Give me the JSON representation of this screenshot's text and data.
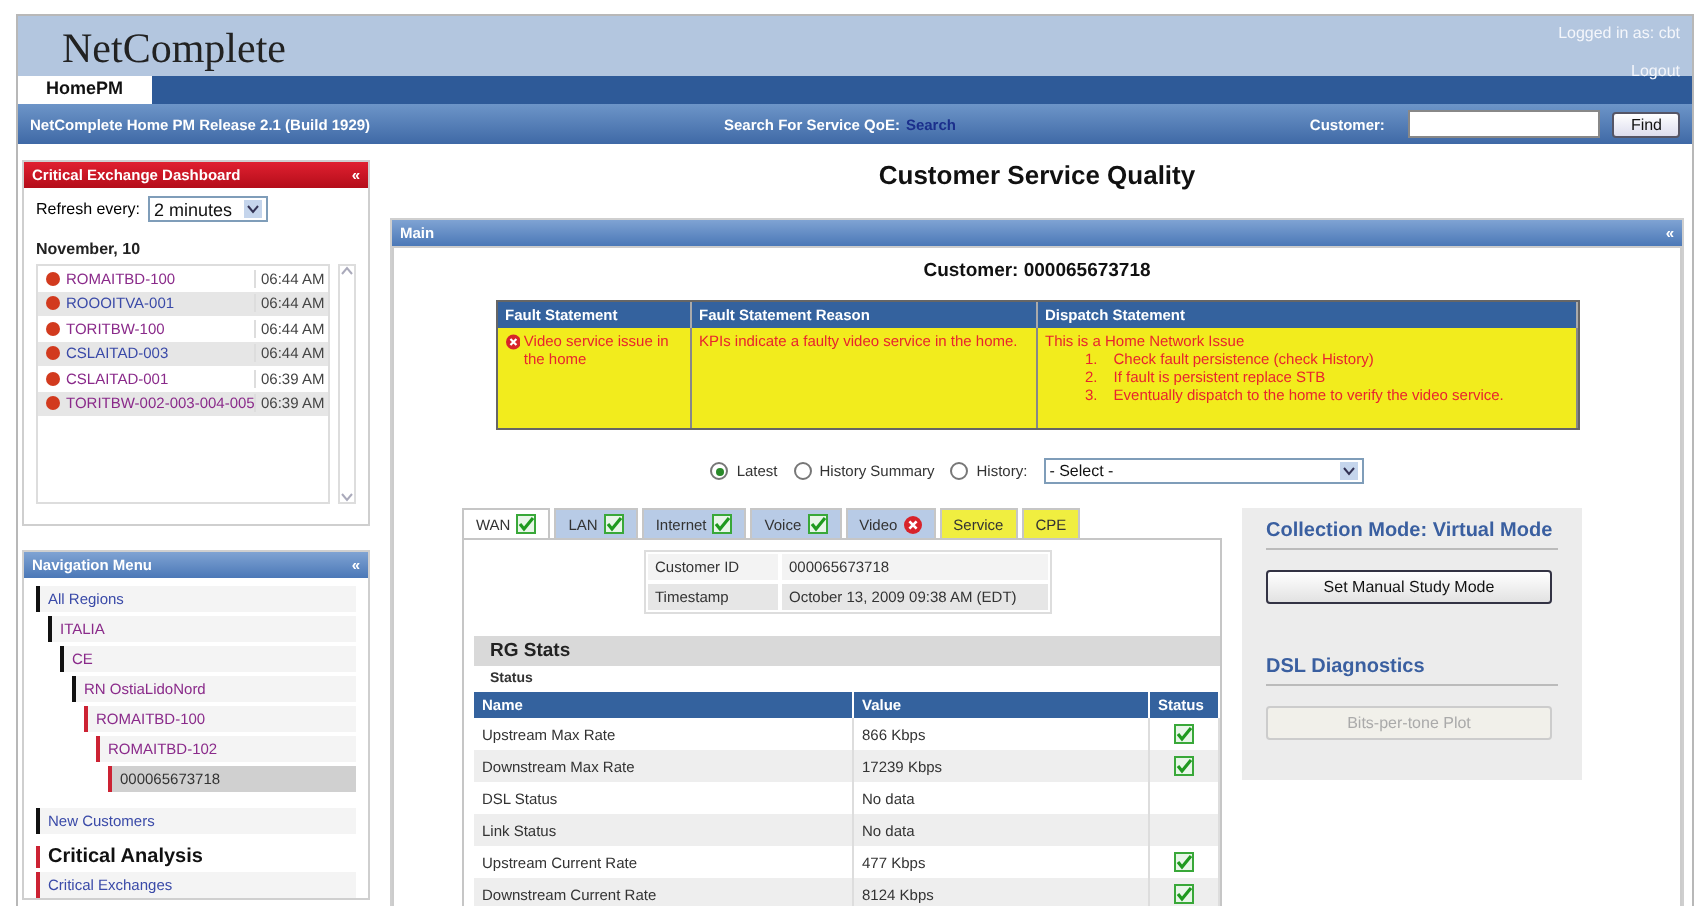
{
  "header": {
    "logo": "NetComplete",
    "logged_in": "Logged in as: cbt",
    "logout": "Logout"
  },
  "app_tabs": [
    {
      "label": "HomePM",
      "selected": true
    }
  ],
  "subbar": {
    "release": "NetComplete Home PM Release 2.1 (Build 1929)",
    "search_label": "Search For Service QoE:",
    "search_link": "Search",
    "customer_label": "Customer:",
    "find_button": "Find"
  },
  "dashboard": {
    "title": "Critical Exchange Dashboard",
    "collapse": "«",
    "refresh_label": "Refresh every:",
    "refresh_value": "2 minutes",
    "date": "November, 10",
    "rows": [
      {
        "name": "ROMAITBD-100",
        "time": "06:44 AM",
        "visited": true
      },
      {
        "name": "ROOOITVA-001",
        "time": "06:44 AM",
        "visited": false
      },
      {
        "name": "TORITBW-100",
        "time": "06:44 AM",
        "visited": true
      },
      {
        "name": "CSLAITAD-003",
        "time": "06:44 AM",
        "visited": false
      },
      {
        "name": "CSLAITAD-001",
        "time": "06:39 AM",
        "visited": true
      },
      {
        "name": "TORITBW-002-003-004-005",
        "time": "06:39 AM",
        "visited": true
      }
    ]
  },
  "navigation": {
    "title": "Navigation Menu",
    "collapse": "«",
    "tree": [
      {
        "label": "All Regions",
        "color": "#111111",
        "selected": false,
        "children": [
          {
            "label": "ITALIA",
            "color": "#111111",
            "selected": false,
            "children": [
              {
                "label": "CE",
                "color": "#111111",
                "selected": false,
                "children": [
                  {
                    "label": "RN OstiaLidoNord",
                    "color": "#111111",
                    "selected": false,
                    "children": [
                      {
                        "label": "ROMAITBD-100",
                        "color": "#cc2233",
                        "selected": false,
                        "children": [
                          {
                            "label": "ROMAITBD-102",
                            "color": "#cc2233",
                            "selected": false,
                            "children": [
                              {
                                "label": "000065673718",
                                "color": "#cc2233",
                                "selected": true
                              }
                            ]
                          }
                        ]
                      }
                    ]
                  }
                ]
              }
            ]
          }
        ]
      },
      {
        "label": "New Customers",
        "color": "#111111",
        "selected": false
      }
    ],
    "section": {
      "title": "Critical Analysis",
      "color": "#cc2233"
    },
    "section_items": [
      {
        "label": "Critical Exchanges",
        "color": "#cc2233",
        "selected": false
      }
    ]
  },
  "page_title": "Customer Service Quality",
  "main": {
    "title": "Main",
    "collapse": "«",
    "customer": "Customer: 000065673718",
    "fault_table": {
      "columns": [
        "Fault Statement",
        "Fault Statement Reason",
        "Dispatch Statement"
      ],
      "fault": "Video service issue in the home",
      "reason": "KPIs indicate a faulty video service in the home.",
      "dispatch_title": "This is a Home Network Issue",
      "dispatch_steps": [
        {
          "number": "1.",
          "text": "Check fault persistence (check History)"
        },
        {
          "number": "2.",
          "text": "If fault is persistent replace STB"
        },
        {
          "number": "3.",
          "text": "Eventually dispatch to the home to verify the video service."
        }
      ]
    },
    "history": [
      {
        "label": "Latest",
        "selected": true
      },
      {
        "label": "History Summary",
        "selected": false
      },
      {
        "label": "History:",
        "selected": false
      }
    ],
    "history_select": "- Select -",
    "tabs": [
      {
        "label": "WAN",
        "kind": "ok",
        "selected": true,
        "highlight": false
      },
      {
        "label": "LAN",
        "kind": "ok",
        "selected": false,
        "highlight": false
      },
      {
        "label": "Internet",
        "kind": "ok",
        "selected": false,
        "highlight": false
      },
      {
        "label": "Voice",
        "kind": "ok",
        "selected": false,
        "highlight": false
      },
      {
        "label": "Video",
        "kind": "error",
        "selected": false,
        "highlight": false
      },
      {
        "label": "Service",
        "kind": "plain",
        "selected": false,
        "highlight": true
      },
      {
        "label": "CPE",
        "kind": "plain",
        "selected": false,
        "highlight": true
      }
    ],
    "info": [
      {
        "label": "Customer ID",
        "value": "000065673718"
      },
      {
        "label": "Timestamp",
        "value": "October 13, 2009 09:38 AM (EDT)"
      }
    ],
    "stats_title": "RG Stats",
    "stats_subtitle": "Status",
    "stats_columns": [
      "Name",
      "Value",
      "Status"
    ],
    "stats": [
      {
        "name": "Upstream Max Rate",
        "value": "866 Kbps",
        "checked": true
      },
      {
        "name": "Downstream Max Rate",
        "value": "17239 Kbps",
        "checked": true
      },
      {
        "name": "DSL Status",
        "value": "No data",
        "checked": false
      },
      {
        "name": "Link Status",
        "value": "No data",
        "checked": false
      },
      {
        "name": "Upstream Current Rate",
        "value": "477 Kbps",
        "checked": true
      },
      {
        "name": "Downstream Current Rate",
        "value": "8124 Kbps",
        "checked": true
      }
    ],
    "collection": {
      "title": "Collection Mode: Virtual Mode",
      "button": "Set Manual Study Mode"
    },
    "diagnostics": {
      "title": "DSL Diagnostics",
      "button": "Bits-per-tone Plot",
      "disabled": true
    }
  }
}
